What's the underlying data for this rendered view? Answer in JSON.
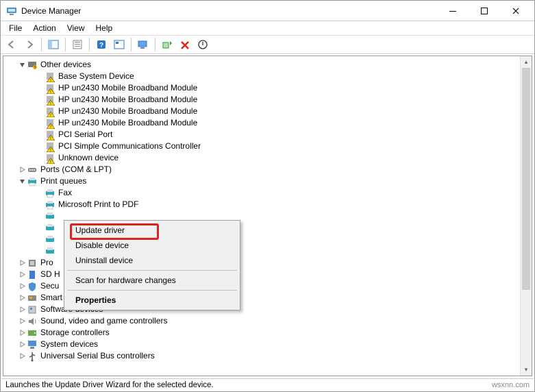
{
  "window": {
    "title": "Device Manager"
  },
  "menus": {
    "file": "File",
    "action": "Action",
    "view": "View",
    "help": "Help"
  },
  "tree": {
    "other_devices": {
      "label": "Other devices",
      "children": {
        "base_system": "Base System Device",
        "bb1": "HP un2430 Mobile Broadband Module",
        "bb2": "HP un2430 Mobile Broadband Module",
        "bb3": "HP un2430 Mobile Broadband Module",
        "bb4": "HP un2430 Mobile Broadband Module",
        "pci_serial": "PCI Serial Port",
        "pci_comm": "PCI Simple Communications Controller",
        "unknown": "Unknown device"
      }
    },
    "ports": {
      "label": "Ports (COM & LPT)"
    },
    "print_queues": {
      "label": "Print queues",
      "children": {
        "fax": "Fax",
        "ms_pdf": "Microsoft Print to PDF"
      }
    },
    "processors": {
      "label": "Pro"
    },
    "sd_host": {
      "label": "SD H"
    },
    "security": {
      "label": "Secu"
    },
    "smart_card": {
      "label": "Smart card readers"
    },
    "software": {
      "label": "Software devices"
    },
    "sound": {
      "label": "Sound, video and game controllers"
    },
    "storage": {
      "label": "Storage controllers"
    },
    "system": {
      "label": "System devices"
    },
    "usb": {
      "label": "Universal Serial Bus controllers"
    }
  },
  "context_menu": {
    "update": "Update driver",
    "disable": "Disable device",
    "uninstall": "Uninstall device",
    "scan": "Scan for hardware changes",
    "properties": "Properties"
  },
  "statusbar": {
    "text": "Launches the Update Driver Wizard for the selected device.",
    "watermark": "wsxnn.com"
  }
}
